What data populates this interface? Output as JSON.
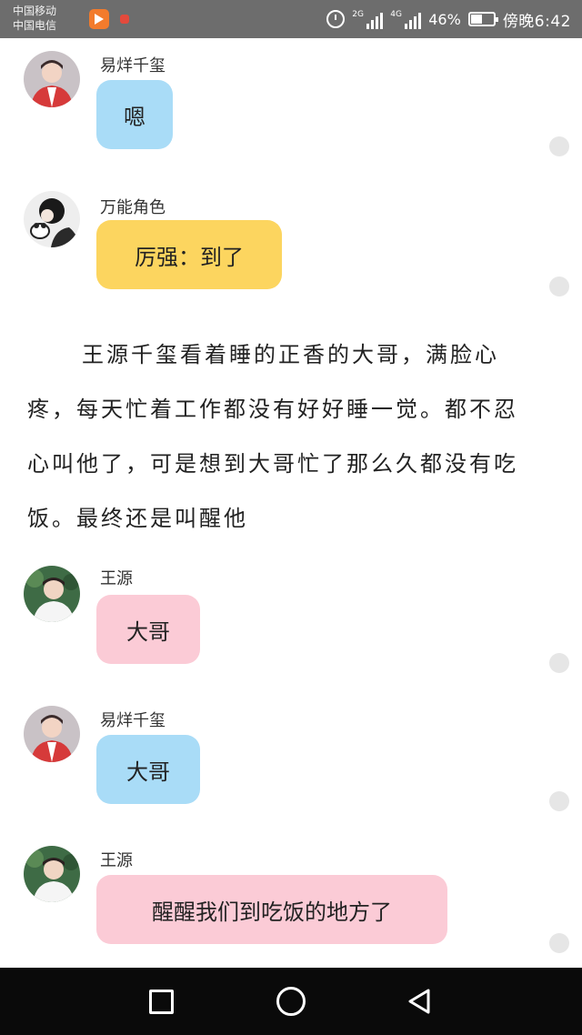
{
  "status_bar": {
    "carrier_line1": "中国移动",
    "carrier_line2": "中国电信",
    "network1": "2G",
    "network2": "4G",
    "battery": "46%",
    "time": "傍晚6:42"
  },
  "messages": [
    {
      "speaker": "易烊千玺",
      "text": "嗯",
      "color": "#a9dcf7"
    },
    {
      "speaker": "万能角色",
      "text": "厉强：到了",
      "color": "#fcd55f"
    },
    {
      "speaker": "王源",
      "text": "大哥",
      "color": "#fbcbd6"
    },
    {
      "speaker": "易烊千玺",
      "text": "大哥",
      "color": "#a9dcf7"
    },
    {
      "speaker": "王源",
      "text": "醒醒我们到吃饭的地方了",
      "color": "#fbcbd6"
    }
  ],
  "narration": "王源千玺看着睡的正香的大哥，满脸心疼，每天忙着工作都没有好好睡一觉。都不忍心叫他了，可是想到大哥忙了那么久都没有吃饭。最终还是叫醒他",
  "nav": {
    "recent_icon": "square-icon",
    "home_icon": "circle-icon",
    "back_icon": "triangle-back-icon"
  }
}
